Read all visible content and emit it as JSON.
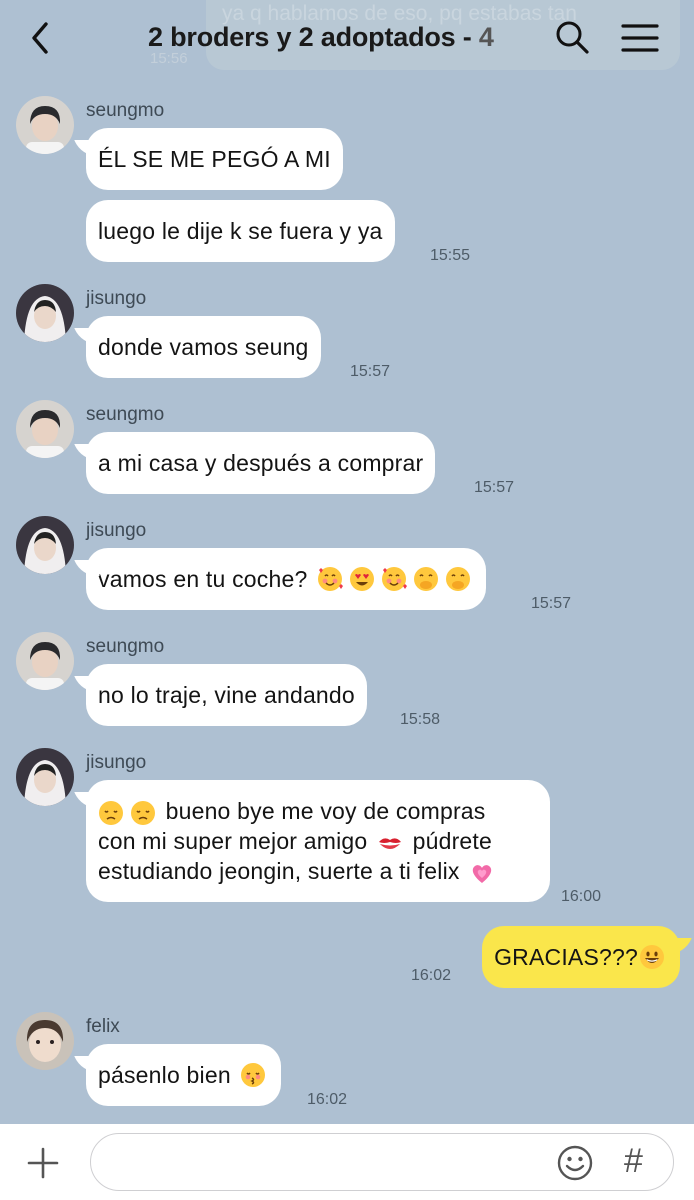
{
  "header": {
    "title": "2 broders y 2 adoptados - ",
    "member_count": "4",
    "prev_message_fragment": "ya q hablamos de eso, pq estabas tan",
    "prev_time_fragment": "15:56"
  },
  "messages": [
    {
      "sender": "seungmo",
      "lines": [
        "ÉL SE ME PEGÓ A MI"
      ]
    },
    {
      "lines": [
        "luego le dije k se fuera y ya"
      ],
      "time": "15:55"
    },
    {
      "sender": "jisungo",
      "lines": [
        "donde vamos seung"
      ],
      "time": "15:57"
    },
    {
      "sender": "seungmo",
      "lines": [
        "a mi casa y después a comprar"
      ],
      "time": "15:57"
    },
    {
      "sender": "jisungo",
      "lines": [
        "vamos en tu coche?"
      ],
      "time": "15:57",
      "emojis": [
        "smiling-face-with-hearts",
        "heart-eyes",
        "smiling-face-with-hearts",
        "face-with-hand-over-mouth",
        "face-with-hand-over-mouth"
      ]
    },
    {
      "sender": "seungmo",
      "lines": [
        "no lo traje, vine andando"
      ],
      "time": "15:58"
    },
    {
      "sender": "jisungo",
      "lines": [
        "bueno bye me voy de compras",
        "con mi super mejor amigo",
        "púdrete",
        "estudiando jeongin, suerte a ti felix"
      ],
      "time": "16:00",
      "emojis": [
        "disappointed-face",
        "disappointed-face",
        "kiss-mark",
        "growing-heart"
      ]
    },
    {
      "own": true,
      "lines": [
        "GRACIAS???"
      ],
      "time": "16:02",
      "emojis": [
        "grinning-face"
      ]
    },
    {
      "sender": "felix",
      "lines": [
        "pásenlo bien"
      ],
      "time": "16:02",
      "emojis": [
        "kissing-face-closed-eyes"
      ]
    }
  ],
  "input": {
    "placeholder": ""
  },
  "icons": {
    "back": "chevron-left-icon",
    "search": "search-icon",
    "menu": "hamburger-menu-icon",
    "add": "plus-icon",
    "emoji": "smiley-icon",
    "hashtag": "hashtag-icon"
  },
  "colors": {
    "background": "#aec0d2",
    "own_bubble": "#fae64b",
    "other_bubble": "#ffffff",
    "input_bar": "#ffffff"
  }
}
